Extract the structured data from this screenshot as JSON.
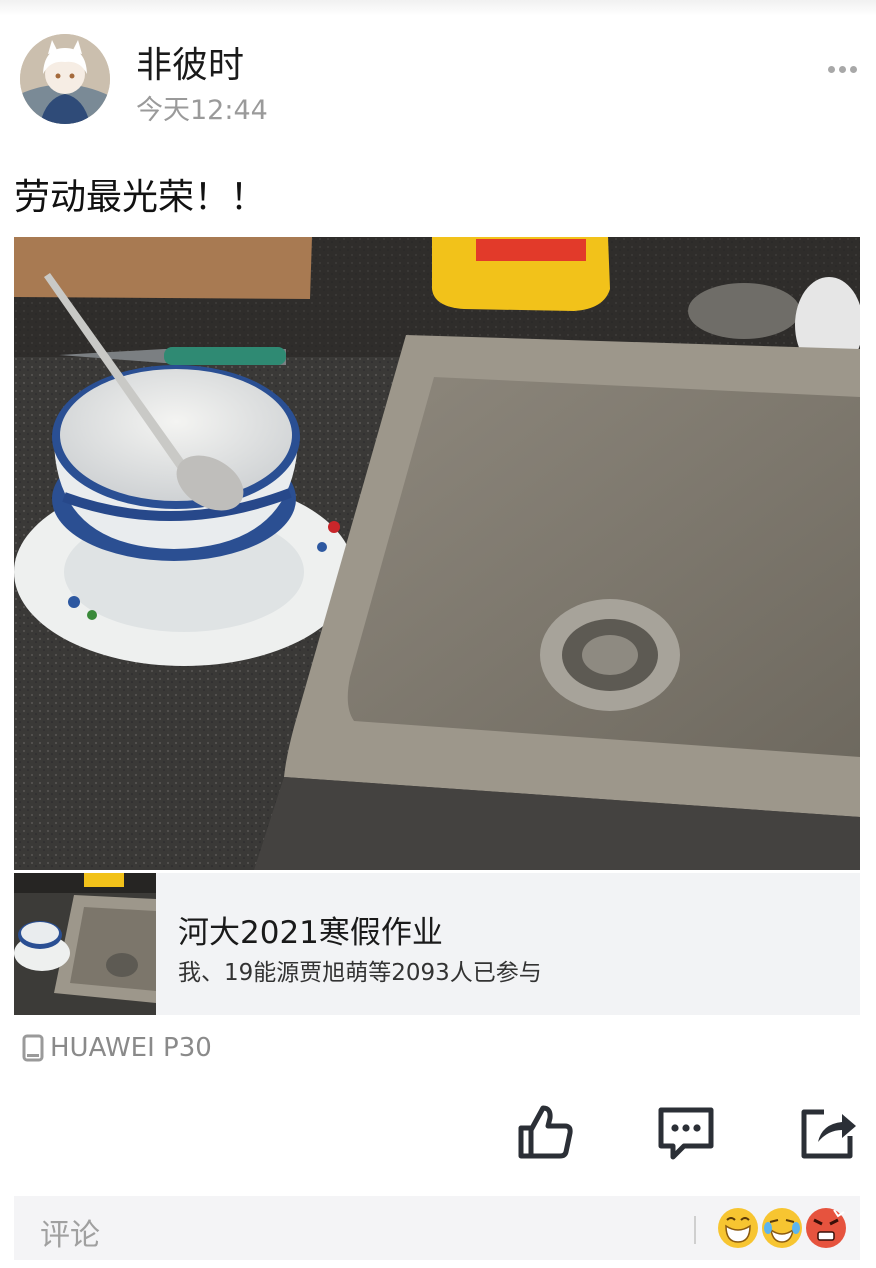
{
  "post": {
    "author": "非彼时",
    "time": "今天12:44",
    "text": "劳动最光荣！！"
  },
  "share_card": {
    "title": "河大2021寒假作业",
    "subtitle": "我、19能源贾旭萌等2093人已参与"
  },
  "device": {
    "label": "HUAWEI P30",
    "icon": "phone-icon"
  },
  "actions": {
    "icons": [
      "thumbs-up-icon",
      "comment-icon",
      "share-icon"
    ]
  },
  "comment_bar": {
    "placeholder": "评论",
    "emoji_icons": [
      "grin-emoji-icon",
      "laugh-cry-emoji-icon",
      "angry-emoji-icon"
    ]
  },
  "colors": {
    "secondary_text": "#9a9a9a",
    "card_bg": "#f2f3f5",
    "icon_dark": "#2b2f36"
  }
}
